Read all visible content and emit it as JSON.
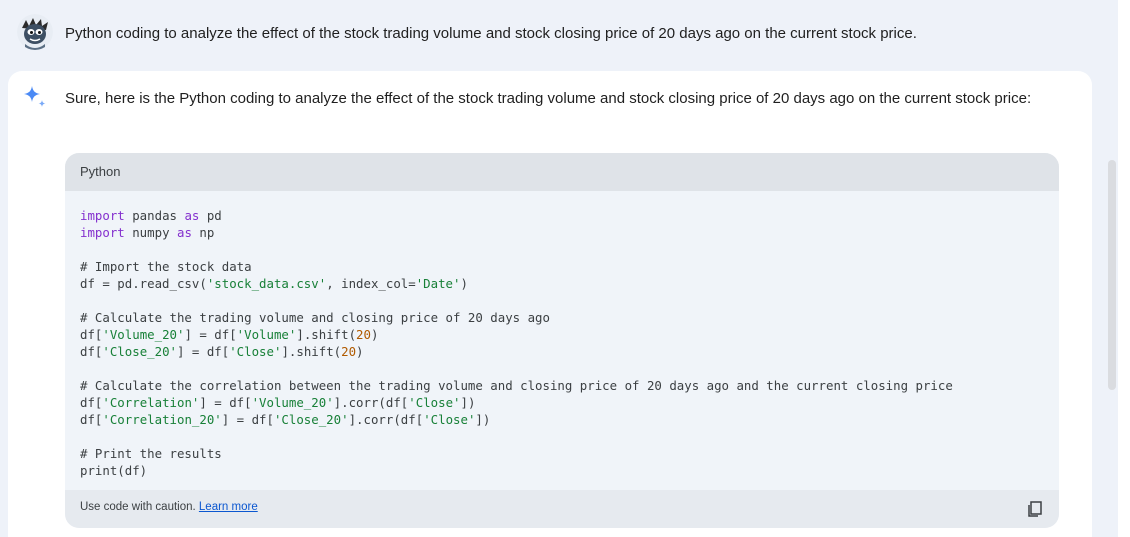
{
  "user_prompt": {
    "text": "Python coding to analyze the effect of the stock trading volume and stock closing price of 20 days ago on the current stock price.",
    "avatar_icon": "cartoon-avatar-icon"
  },
  "response": {
    "intro": "Sure, here is the Python coding to analyze the effect of the stock trading volume and stock closing price of 20 days ago on the current stock price:",
    "code_block": {
      "language": "Python",
      "lines": [
        "import pandas as pd",
        "import numpy as np",
        "",
        "# Import the stock data",
        "df = pd.read_csv('stock_data.csv', index_col='Date')",
        "",
        "# Calculate the trading volume and closing price of 20 days ago",
        "df['Volume_20'] = df['Volume'].shift(20)",
        "df['Close_20'] = df['Close'].shift(20)",
        "",
        "# Calculate the correlation between the trading volume and closing price of 20 days ago and the current closing price",
        "df['Correlation'] = df['Volume_20'].corr(df['Close'])",
        "df['Correlation_20'] = df['Close_20'].corr(df['Close'])",
        "",
        "# Print the results",
        "print(df)"
      ],
      "caution_text": "Use code with caution.",
      "learn_more_label": "Learn more",
      "copy_icon": "copy-icon"
    }
  },
  "colors": {
    "keyword": "#8430ce",
    "string": "#188038",
    "number": "#b05a00",
    "link": "#0b57d0",
    "sparkle": "#4b8af5"
  }
}
